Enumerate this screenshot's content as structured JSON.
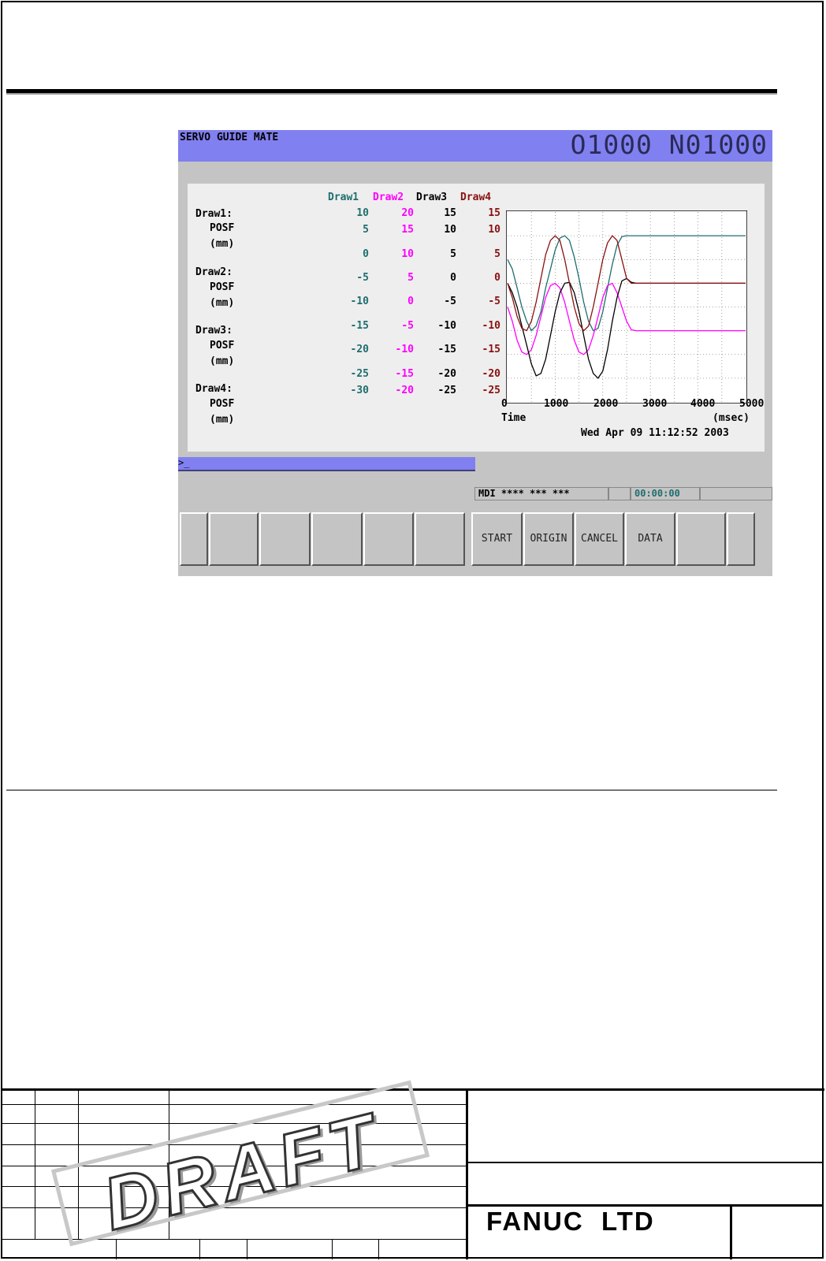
{
  "screen": {
    "app_title": "SERVO GUIDE MATE",
    "program_number": "O1000 N01000",
    "command_prompt": ">_"
  },
  "graph": {
    "series_headers": [
      "Draw1",
      "Draw2",
      "Draw3",
      "Draw4"
    ],
    "channel_labels": [
      {
        "name": "Draw1:",
        "signal": "POSF",
        "unit": "(mm)"
      },
      {
        "name": "Draw2:",
        "signal": "POSF",
        "unit": "(mm)"
      },
      {
        "name": "Draw3:",
        "signal": "POSF",
        "unit": "(mm)"
      },
      {
        "name": "Draw4:",
        "signal": "POSF",
        "unit": "(mm)"
      }
    ],
    "y_ticks": {
      "draw1": [
        "10",
        "5",
        "0",
        "-5",
        "-10",
        "-15",
        "-20",
        "-25",
        "-30"
      ],
      "draw2": [
        "20",
        "15",
        "10",
        "5",
        "0",
        "-5",
        "-10",
        "-15",
        "-20"
      ],
      "draw3": [
        "15",
        "10",
        "5",
        "0",
        "-5",
        "-10",
        "-15",
        "-20",
        "-25"
      ],
      "draw4": [
        "15",
        "10",
        "5",
        "0",
        "-5",
        "-10",
        "-15",
        "-20",
        "-25"
      ]
    },
    "x_ticks": [
      "0",
      "1000",
      "2000",
      "3000",
      "4000",
      "5000"
    ],
    "x_label": "Time",
    "x_unit": "(msec)",
    "timestamp": "Wed Apr 09 11:12:52 2003",
    "colors": {
      "draw1": "#1f6e6e",
      "draw2": "#ff00ff",
      "draw3": "#000000",
      "draw4": "#8a1010"
    }
  },
  "chart_data": {
    "type": "line",
    "xlabel": "Time",
    "xlim": [
      0,
      5000
    ],
    "x": [
      0,
      100,
      200,
      300,
      400,
      500,
      600,
      700,
      800,
      900,
      1000,
      1100,
      1200,
      1300,
      1400,
      1500,
      1600,
      1700,
      1800,
      1900,
      2000,
      2100,
      2200,
      2300,
      2400,
      2500,
      2600,
      2700,
      2800,
      3000,
      3500,
      4000,
      4500,
      5000
    ],
    "series": [
      {
        "name": "Draw1",
        "ylim": [
          -30,
          10
        ],
        "values": [
          0,
          -2,
          -6,
          -10,
          -13,
          -15,
          -14,
          -11,
          -6,
          -2,
          2,
          4.5,
          5,
          4,
          0.5,
          -4,
          -9,
          -13,
          -15,
          -14.5,
          -11,
          -6,
          -1,
          3,
          4.8,
          5,
          5,
          5,
          5,
          5,
          5,
          5,
          5,
          5
        ]
      },
      {
        "name": "Draw2",
        "ylim": [
          -20,
          20
        ],
        "values": [
          0,
          -3,
          -7,
          -9.5,
          -10,
          -9,
          -6,
          -2,
          2,
          4.5,
          5,
          4,
          1,
          -3,
          -7,
          -9.5,
          -10,
          -9,
          -6,
          -2,
          2,
          4.5,
          5,
          3,
          0,
          -3,
          -4.8,
          -5,
          -5,
          -5,
          -5,
          -5,
          -5,
          -5
        ]
      },
      {
        "name": "Draw3",
        "ylim": [
          -25,
          15
        ],
        "values": [
          0,
          -2,
          -5,
          -9,
          -13,
          -17,
          -19.5,
          -19,
          -16,
          -11,
          -6,
          -2,
          0,
          0.2,
          -2,
          -6,
          -11,
          -16,
          -19,
          -20,
          -18.5,
          -14,
          -8,
          -3,
          0.5,
          1,
          0.2,
          0,
          0,
          0,
          0,
          0,
          0,
          0
        ]
      },
      {
        "name": "Draw4",
        "ylim": [
          -25,
          15
        ],
        "values": [
          0,
          -3,
          -7,
          -9.5,
          -10,
          -8,
          -4,
          1,
          6,
          9,
          10,
          9,
          5,
          0,
          -5,
          -8.5,
          -10,
          -9,
          -5,
          0,
          5,
          8.5,
          10,
          9,
          5,
          1,
          0,
          0,
          0,
          0,
          0,
          0,
          0,
          0
        ]
      }
    ]
  },
  "status_bar": {
    "mode": "MDI **** *** ***",
    "time": "00:00:00"
  },
  "softkeys": [
    "",
    "",
    "",
    "",
    "",
    "",
    "START",
    "ORIGIN",
    "CANCEL",
    "DATA",
    "",
    ""
  ],
  "title_block": {
    "stamp": "DRAFT",
    "company": "FANUC  LTD"
  }
}
